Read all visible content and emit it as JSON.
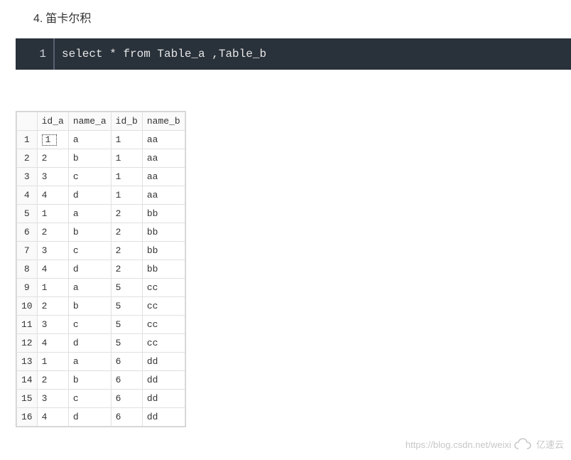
{
  "heading": {
    "num": "4.",
    "text": "笛卡尔积"
  },
  "code": {
    "line_no": "1",
    "sql": "select * from Table_a ,Table_b"
  },
  "table": {
    "headers": [
      "id_a",
      "name_a",
      "id_b",
      "name_b"
    ],
    "rows": [
      [
        "1",
        "1",
        "a",
        "1",
        "aa"
      ],
      [
        "2",
        "2",
        "b",
        "1",
        "aa"
      ],
      [
        "3",
        "3",
        "c",
        "1",
        "aa"
      ],
      [
        "4",
        "4",
        "d",
        "1",
        "aa"
      ],
      [
        "5",
        "1",
        "a",
        "2",
        "bb"
      ],
      [
        "6",
        "2",
        "b",
        "2",
        "bb"
      ],
      [
        "7",
        "3",
        "c",
        "2",
        "bb"
      ],
      [
        "8",
        "4",
        "d",
        "2",
        "bb"
      ],
      [
        "9",
        "1",
        "a",
        "5",
        "cc"
      ],
      [
        "10",
        "2",
        "b",
        "5",
        "cc"
      ],
      [
        "11",
        "3",
        "c",
        "5",
        "cc"
      ],
      [
        "12",
        "4",
        "d",
        "5",
        "cc"
      ],
      [
        "13",
        "1",
        "a",
        "6",
        "dd"
      ],
      [
        "14",
        "2",
        "b",
        "6",
        "dd"
      ],
      [
        "15",
        "3",
        "c",
        "6",
        "dd"
      ],
      [
        "16",
        "4",
        "d",
        "6",
        "dd"
      ]
    ]
  },
  "watermark": {
    "url": "https://blog.csdn.net/weixi",
    "brand": "亿速云"
  }
}
